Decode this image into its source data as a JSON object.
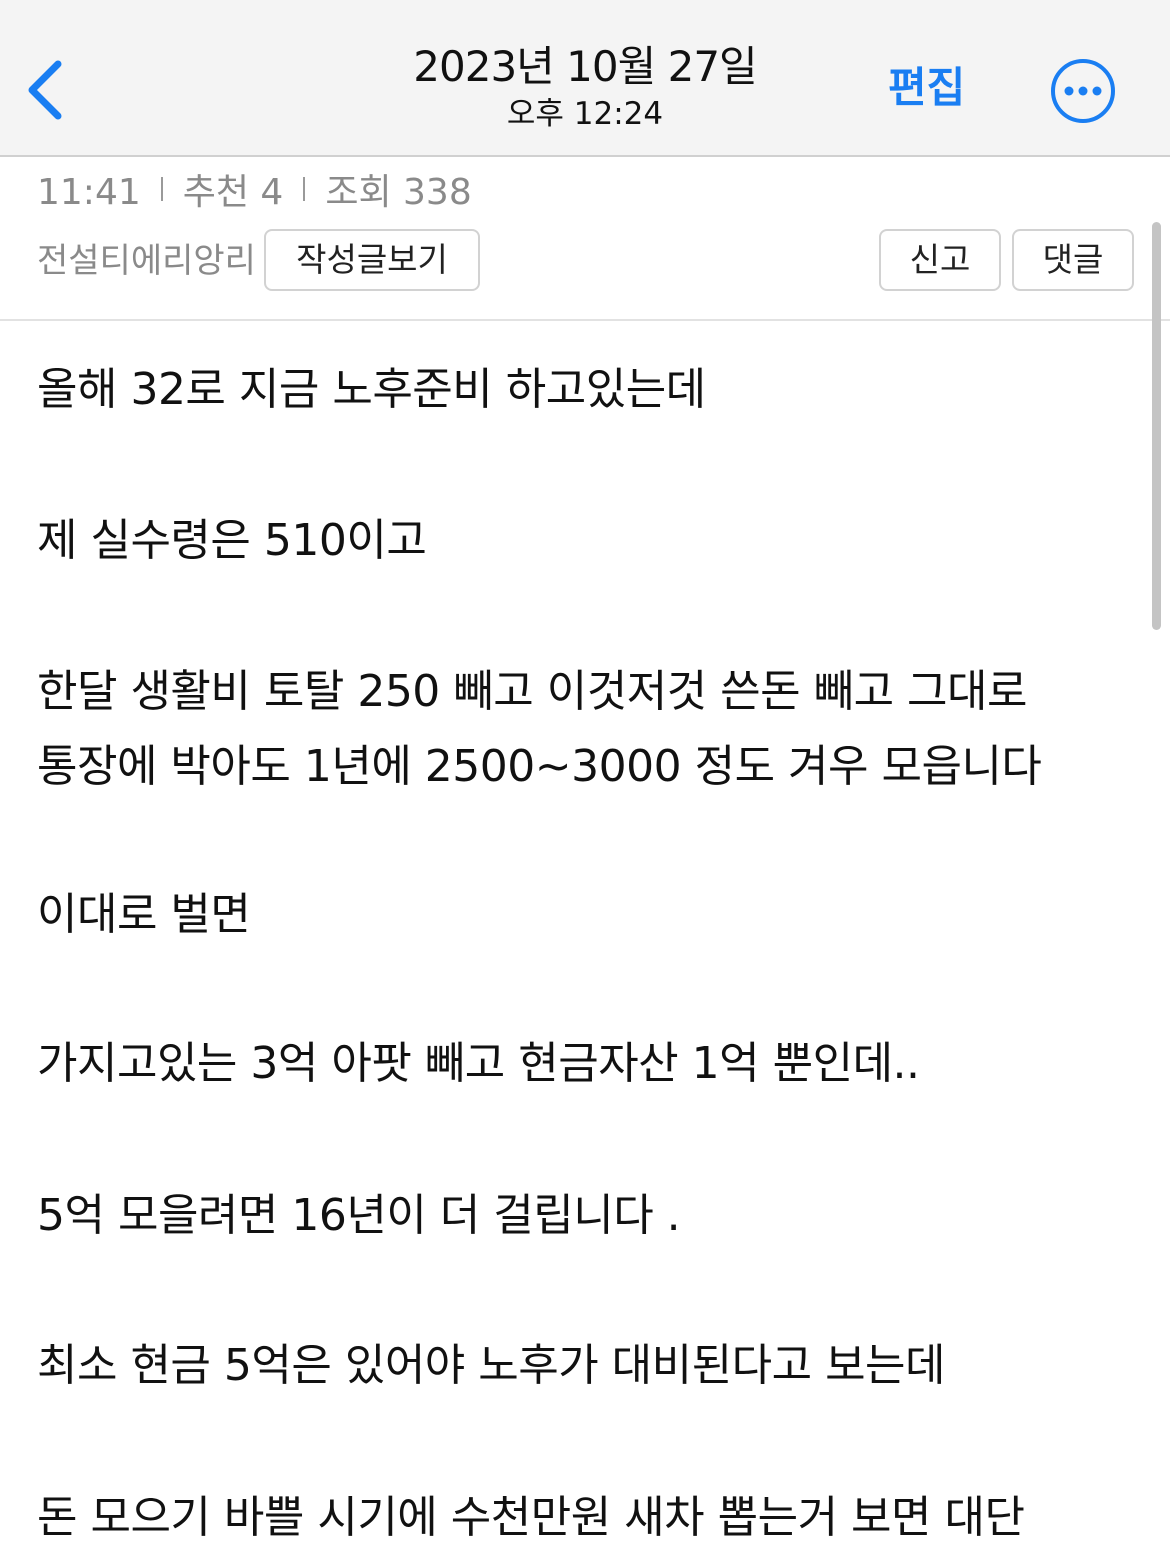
{
  "header": {
    "date": "2023년 10월 27일",
    "time": "오후 12:24",
    "edit_label": "편집"
  },
  "meta": {
    "time": "11:41",
    "likes": "추천 4",
    "views": "조회 338",
    "author": "전설티에리앙리",
    "view_posts_label": "작성글보기",
    "report_label": "신고",
    "comment_label": "댓글"
  },
  "body": {
    "paragraphs": [
      "올해 32로 지금 노후준비 하고있는데",
      "제 실수령은 510이고",
      "한달 생활비 토탈 250 빼고 이것저것 쓴돈 빼고 그대로",
      "통장에 박아도 1년에 2500~3000 정도 겨우 모읍니다",
      "이대로 벌면",
      "가지고있는 3억 아팟 빼고 현금자산 1억 뿐인데..",
      "5억 모을려면 16년이 더 걸립니다 .",
      "최소 현금 5억은 있어야 노후가 대비된다고 보는데",
      "돈 모으기 바쁠 시기에 수천만원 새차 뽑는거 보면 대단"
    ]
  },
  "colors": {
    "accent": "#1a7ef2",
    "meta_text": "#8a8a8a",
    "navbar_bg": "#f4f4f4"
  },
  "icons": {
    "back": "chevron-left-icon",
    "more": "ellipsis-circle-icon"
  }
}
